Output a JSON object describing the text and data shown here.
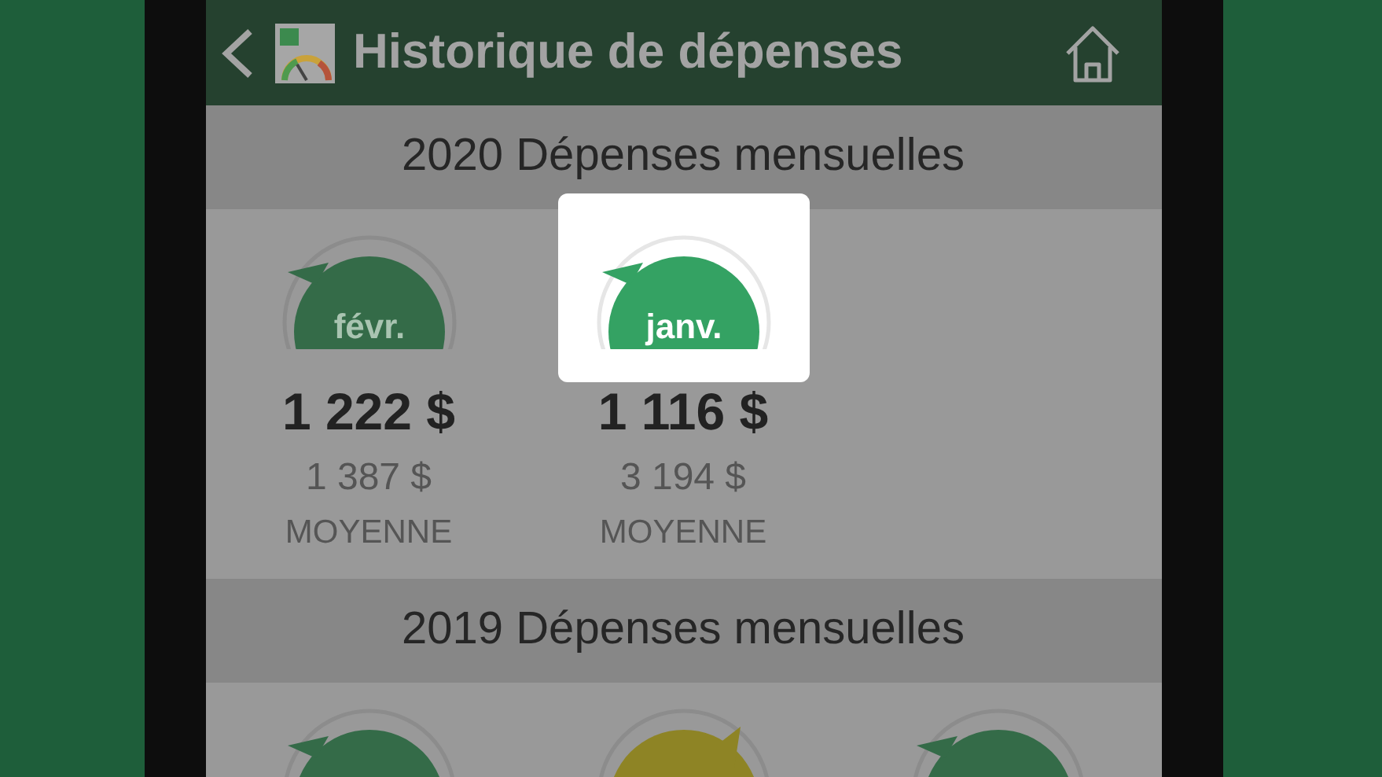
{
  "header": {
    "title": "Historique de dépenses"
  },
  "sections": [
    {
      "title": "2020 Dépenses mensuelles",
      "months": [
        {
          "label": "févr.",
          "color": "#346b48",
          "tail_right": false,
          "highlighted": false,
          "amount": "1 222 $",
          "average": "1 387 $",
          "average_label": "MOYENNE"
        },
        {
          "label": "janv.",
          "color": "#34a263",
          "tail_right": false,
          "highlighted": true,
          "amount": "1 116 $",
          "average": "3 194 $",
          "average_label": "MOYENNE"
        }
      ]
    },
    {
      "title": "2019 Dépenses mensuelles",
      "months": [
        {
          "color": "#346b48",
          "tail_right": false,
          "highlighted": false
        },
        {
          "color": "#8e8425",
          "tail_right": true,
          "highlighted": false
        },
        {
          "color": "#346b48",
          "tail_right": false,
          "highlighted": false
        }
      ]
    }
  ]
}
